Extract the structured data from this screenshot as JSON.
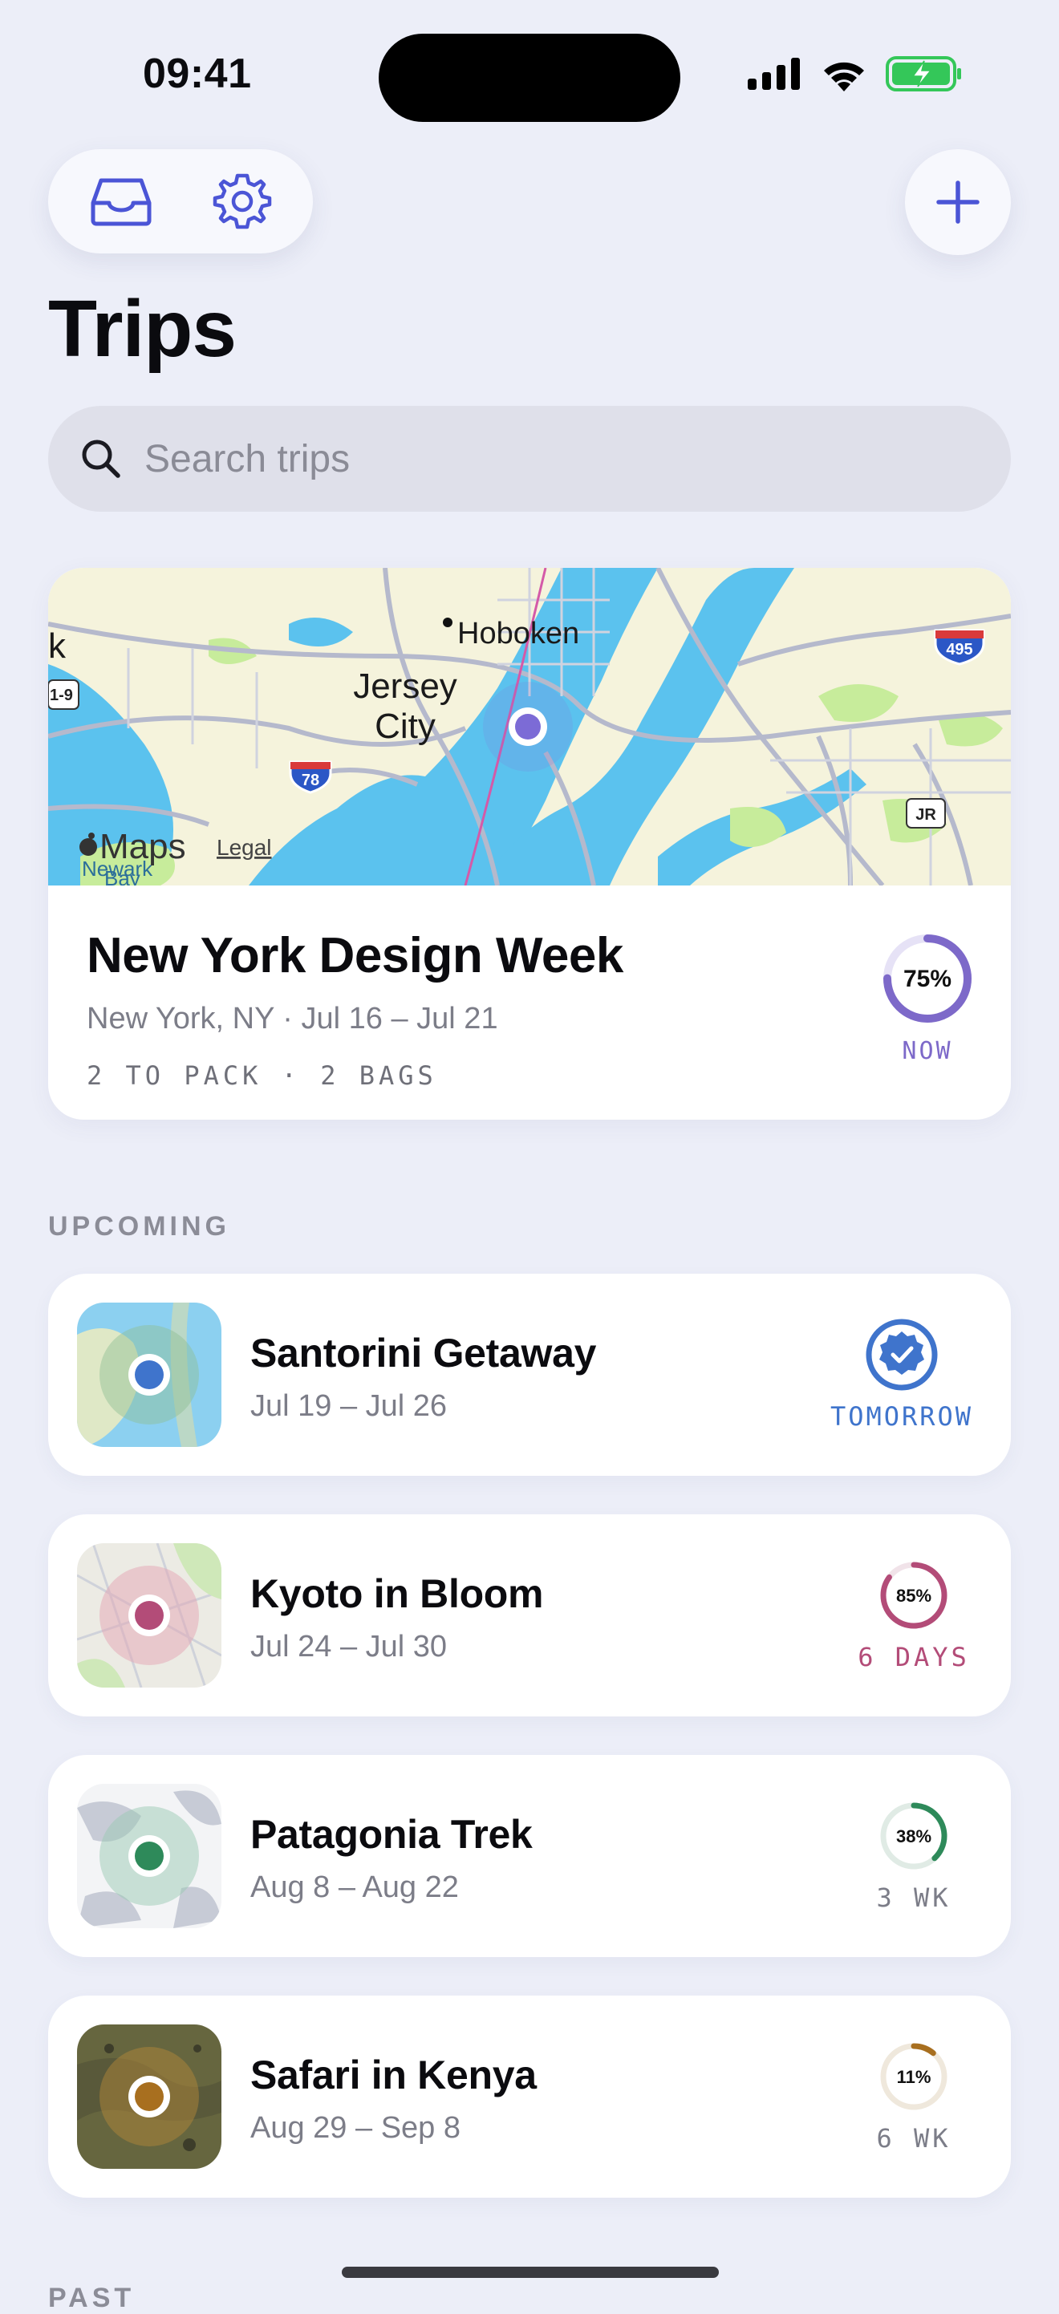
{
  "status_bar": {
    "time": "09:41"
  },
  "toolbar": {
    "inbox_icon": "tray-icon",
    "settings_icon": "gear-icon",
    "add_icon": "plus-icon"
  },
  "page": {
    "title": "Trips"
  },
  "search": {
    "placeholder": "Search trips",
    "value": ""
  },
  "featured": {
    "title": "New York Design Week",
    "subtitle": "New York, NY · Jul 16 – Jul 21",
    "meta": "2 TO PACK · 2 BAGS",
    "progress_label": "75%",
    "progress": 0.75,
    "status": "NOW",
    "accent": "#7d69c9",
    "map": {
      "labels": [
        "Hoboken",
        "Jersey",
        "City",
        "Maps",
        "Legal",
        "Newark",
        "Bay",
        "k",
        "1-9",
        "78",
        "495",
        "JR"
      ]
    }
  },
  "sections": {
    "upcoming": "UPCOMING",
    "past": "PAST"
  },
  "upcoming": [
    {
      "title": "Santorini Getaway",
      "dates": "Jul 19 – Jul 26",
      "status": "TOMORROW",
      "badge": "verified-check-icon",
      "accent": "#3f74cc"
    },
    {
      "title": "Kyoto in Bloom",
      "dates": "Jul 24 – Jul 30",
      "progress_label": "85%",
      "progress": 0.85,
      "status": "6 DAYS",
      "accent": "#b34c78"
    },
    {
      "title": "Patagonia Trek",
      "dates": "Aug 8 – Aug 22",
      "progress_label": "38%",
      "progress": 0.38,
      "status": "3 WK",
      "accent": "#2e8a5a"
    },
    {
      "title": "Safari in Kenya",
      "dates": "Aug 29 – Sep 8",
      "progress_label": "11%",
      "progress": 0.11,
      "status": "6 WK",
      "accent": "#a86f1f"
    }
  ]
}
